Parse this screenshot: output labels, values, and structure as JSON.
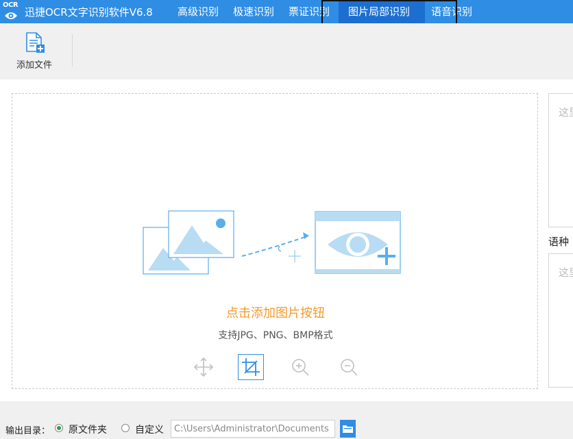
{
  "titlebar": {
    "logo_text": "OCR",
    "app_title": "迅捷OCR文字识别软件V6.8",
    "tabs": [
      {
        "label": "高级识别"
      },
      {
        "label": "极速识别"
      },
      {
        "label": "票证识别"
      },
      {
        "label": "图片局部识别",
        "active": true
      },
      {
        "label": "语音识别"
      }
    ]
  },
  "toolbar": {
    "add_file_label": "添加文件"
  },
  "dropzone": {
    "title": "点击添加图片按钮",
    "subtitle": "支持JPG、PNG、BMP格式",
    "tools": [
      "move-icon",
      "crop-icon",
      "zoom-in-icon",
      "zoom-out-icon"
    ]
  },
  "right_panel": {
    "result_placeholder": "这里",
    "lang_label": "语种",
    "result_placeholder_2": "这里"
  },
  "output": {
    "label": "输出目录：",
    "option_original": "原文件夹",
    "option_custom": "自定义",
    "path_value": "C:\\Users\\Administrator\\Documents"
  },
  "colors": {
    "brand_blue": "#2f8de4",
    "active_tab": "#1c6fd0",
    "accent_orange": "#f39a2e",
    "illustration_blue": "#b8dcf3"
  }
}
